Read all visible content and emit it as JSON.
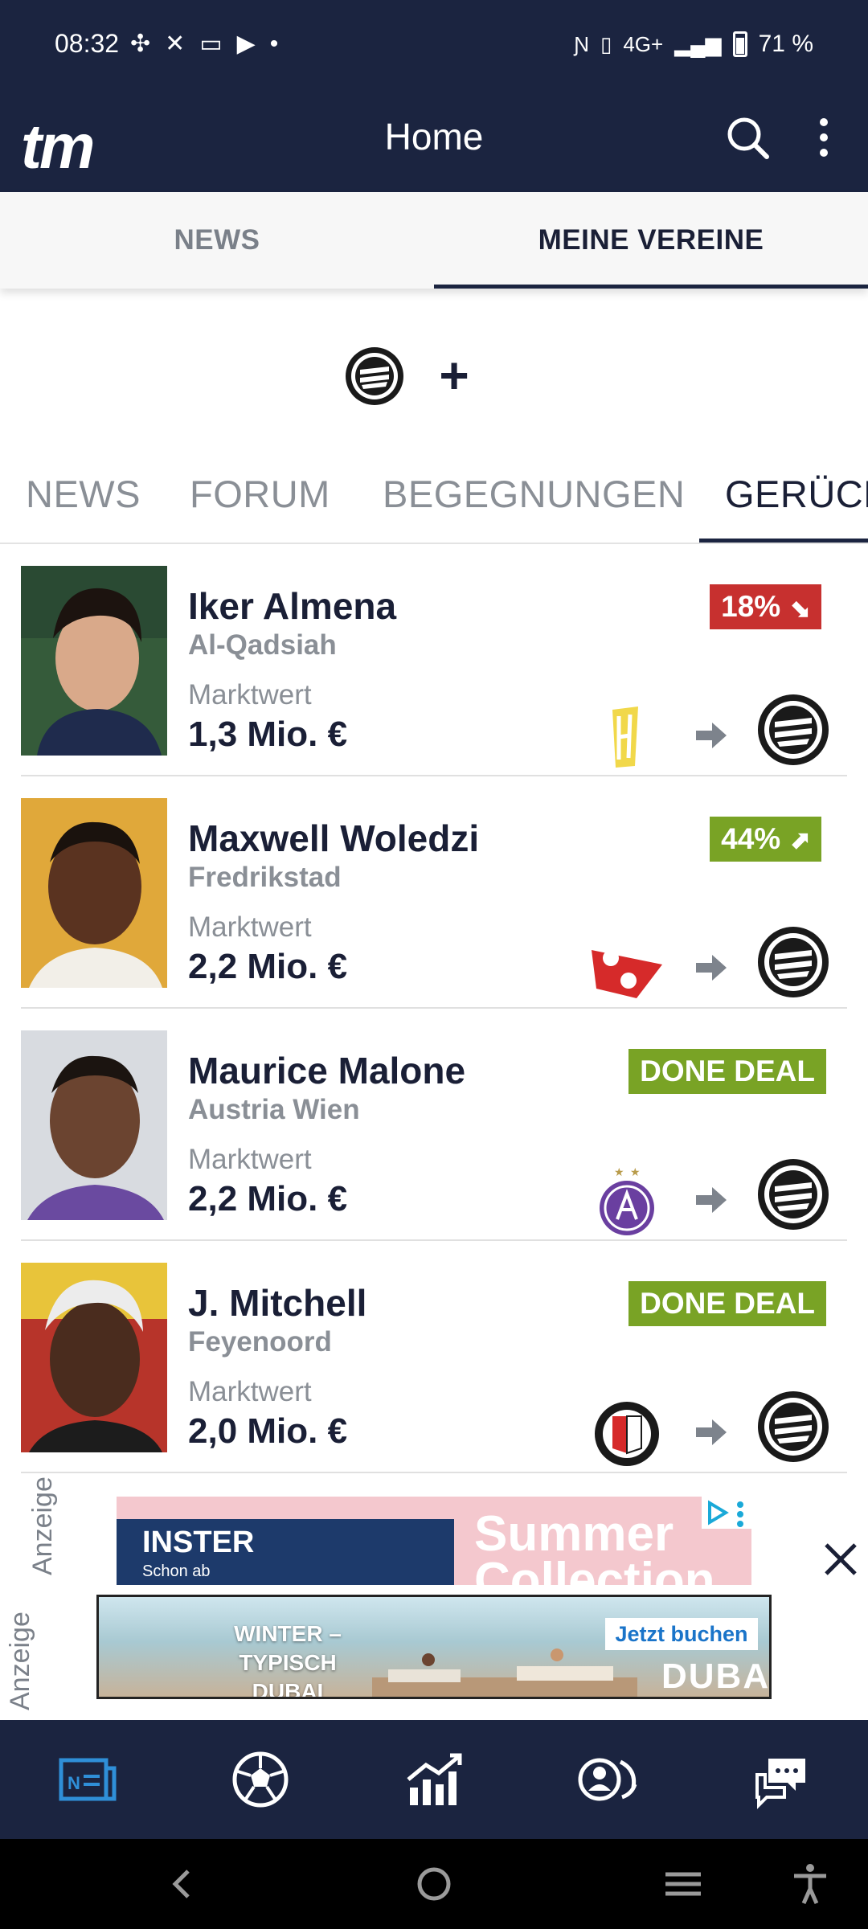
{
  "status_bar": {
    "time": "08:32",
    "network": "4G+",
    "battery": "71 %"
  },
  "app_bar": {
    "logo": "tm",
    "title": "Home"
  },
  "top_tabs": [
    {
      "label": "NEWS",
      "active": false
    },
    {
      "label": "MEINE VEREINE",
      "active": true
    }
  ],
  "club_selector": {
    "add_label": "+"
  },
  "sub_tabs": [
    {
      "label": "NEWS"
    },
    {
      "label": "FORUM"
    },
    {
      "label": "BEGEGNUNGEN"
    },
    {
      "label": "GERÜCH"
    }
  ],
  "rumours": [
    {
      "name": "Iker Almena",
      "club": "Al-Qadsiah",
      "market_label": "Marktwert",
      "market_value": "1,3 Mio. €",
      "badge": "18%",
      "badge_type": "red",
      "from_club_icon": "al-qadsiah-crest-icon",
      "to_club_icon": "sturm-graz-crest-icon"
    },
    {
      "name": "Maxwell Woledzi",
      "club": "Fredrikstad",
      "market_label": "Marktwert",
      "market_value": "2,2 Mio. €",
      "badge": "44%",
      "badge_type": "green",
      "from_club_icon": "fredrikstad-crest-icon",
      "to_club_icon": "sturm-graz-crest-icon"
    },
    {
      "name": "Maurice Malone",
      "club": "Austria Wien",
      "market_label": "Marktwert",
      "market_value": "2,2 Mio. €",
      "badge": "DONE DEAL",
      "badge_type": "deal",
      "from_club_icon": "austria-wien-crest-icon",
      "to_club_icon": "sturm-graz-crest-icon"
    },
    {
      "name": "J. Mitchell",
      "club": "Feyenoord",
      "market_label": "Marktwert",
      "market_value": "2,0 Mio. €",
      "badge": "DONE DEAL",
      "badge_type": "deal",
      "from_club_icon": "feyenoord-crest-icon",
      "to_club_icon": "sturm-graz-crest-icon"
    }
  ],
  "ads": {
    "label": "Anzeige",
    "ad1": {
      "headline": "INSTER",
      "sub": "Schon ab",
      "tagline": "Summer Collection"
    },
    "ad2": {
      "text": "WINTER – TYPISCH DUBAI",
      "cta": "Jetzt buchen",
      "brand": "DUBAI"
    }
  },
  "colors": {
    "navy": "#1b2440",
    "red_badge": "#c7302f",
    "green_badge": "#79a325"
  }
}
